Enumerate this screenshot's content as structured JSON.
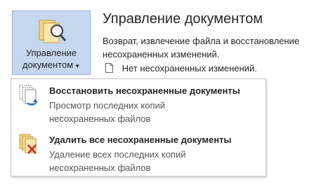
{
  "manage_button": {
    "line1": "Управление",
    "line2": "документом"
  },
  "panel": {
    "title": "Управление документом",
    "description": "Возврат, извлечение файла и восстановление несохраненных изменений.",
    "status": "Нет несохраненных изменений."
  },
  "menu": {
    "items": [
      {
        "title": "Восстановить несохраненные документы",
        "line1": "Просмотр последних копий",
        "line2": "несохраненных файлов",
        "icon": "recover-documents-icon"
      },
      {
        "title": "Удалить все несохраненные документы",
        "line1": "Удаление всех последних копий",
        "line2": "несохраненных файлов",
        "icon": "delete-documents-icon"
      }
    ]
  },
  "colors": {
    "button_bg": "#c5d8f0",
    "button_border": "#8fb3e0",
    "delete_x": "#d9281f",
    "recover_arrow": "#2f6fb5"
  }
}
